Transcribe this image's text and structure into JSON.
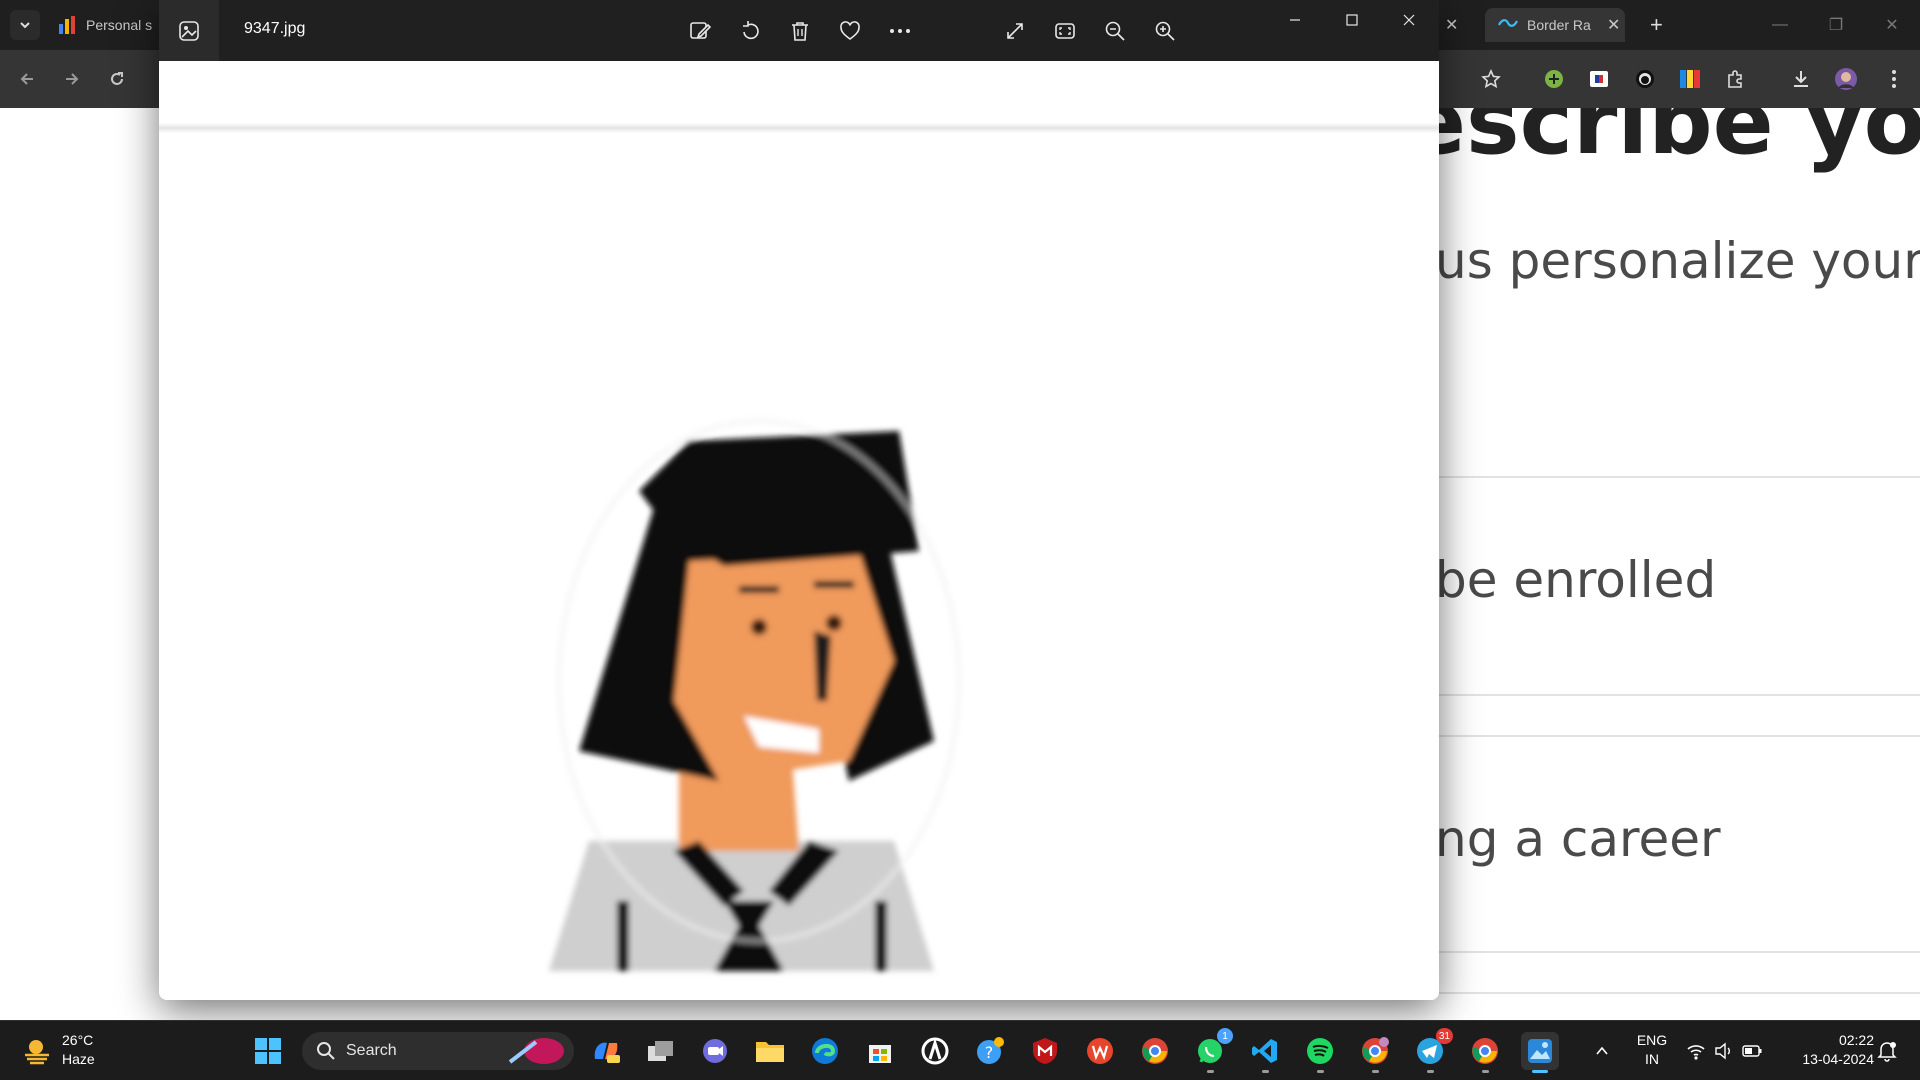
{
  "browser": {
    "tabs": [
      {
        "title": "Personal s",
        "active": false
      },
      {
        "title": "Border Ra",
        "active": true
      }
    ],
    "new_tab": "+",
    "page_text": {
      "heading_fragment": "escribe yo",
      "line1": "us personalize your e",
      "line2": "be enrolled",
      "line3": "ng a career"
    }
  },
  "viewer": {
    "filename": "9347.jpg",
    "toolbar": [
      "edit-image",
      "rotate",
      "delete",
      "favorite",
      "more",
      "fullscreen",
      "fit-to-window",
      "zoom-out",
      "zoom-in"
    ]
  },
  "taskbar": {
    "weather": {
      "temp": "26°C",
      "condition": "Haze"
    },
    "search_placeholder": "Search",
    "badges": {
      "whatsapp": "1",
      "telegram": "31"
    },
    "language": {
      "line1": "ENG",
      "line2": "IN"
    },
    "clock": {
      "time": "02:22",
      "date": "13-04-2024"
    }
  },
  "colors": {
    "accent_blue": "#4aa3ff",
    "window_title_bg": "#202020",
    "browser_toolbar": "#353535"
  }
}
